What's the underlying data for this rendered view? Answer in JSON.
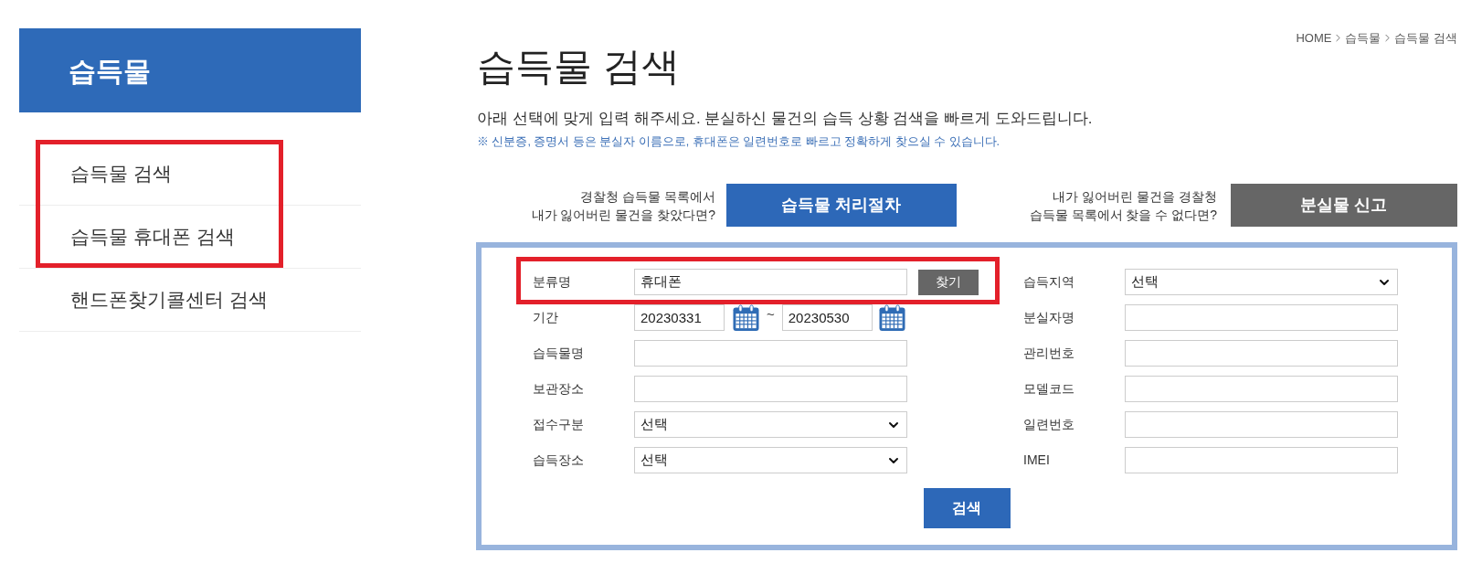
{
  "sidebar": {
    "title": "습득물",
    "items": [
      {
        "label": "습득물 검색"
      },
      {
        "label": "습득물 휴대폰 검색"
      },
      {
        "label": "핸드폰찾기콜센터 검색"
      }
    ]
  },
  "breadcrumb": [
    "HOME",
    "습득물",
    "습득물 검색"
  ],
  "page_title": "습득물 검색",
  "intro": "아래 선택에 맞게 입력 해주세요. 분실하신 물건의 습득 상황 검색을 빠르게 도와드립니다.",
  "note": "※ 신분증, 증명서 등은 분실자 이름으로, 휴대폰은 일련번호로 빠르고 정확하게 찾으실 수 있습니다.",
  "guides": [
    {
      "lines": [
        "경찰청 습득물 목록에서",
        "내가 잃어버린 물건을 찾았다면?"
      ],
      "button": "습득물 처리절차",
      "kind": "primary"
    },
    {
      "lines": [
        "내가 잃어버린 물건을 경찰청",
        "습득물 목록에서 찾을 수 없다면?"
      ],
      "button": "분실물 신고",
      "kind": "secondary"
    }
  ],
  "form": {
    "left": [
      {
        "label": "분류명",
        "kind": "text",
        "value": "휴대폰",
        "button": "찾기"
      },
      {
        "label": "기간",
        "kind": "date_range",
        "from": "20230331",
        "separator": "~",
        "to": "20230530"
      },
      {
        "label": "습득물명",
        "kind": "text"
      },
      {
        "label": "보관장소",
        "kind": "text"
      },
      {
        "label": "접수구분",
        "kind": "select",
        "value": "선택"
      },
      {
        "label": "습득장소",
        "kind": "select",
        "value": "선택"
      }
    ],
    "right": [
      {
        "label": "습득지역",
        "kind": "select",
        "value": "선택"
      },
      {
        "label": "분실자명",
        "kind": "text"
      },
      {
        "label": "관리번호",
        "kind": "text"
      },
      {
        "label": "모델코드",
        "kind": "text"
      },
      {
        "label": "일련번호",
        "kind": "text"
      },
      {
        "label": "IMEI",
        "kind": "text"
      }
    ],
    "submit": "검색"
  }
}
